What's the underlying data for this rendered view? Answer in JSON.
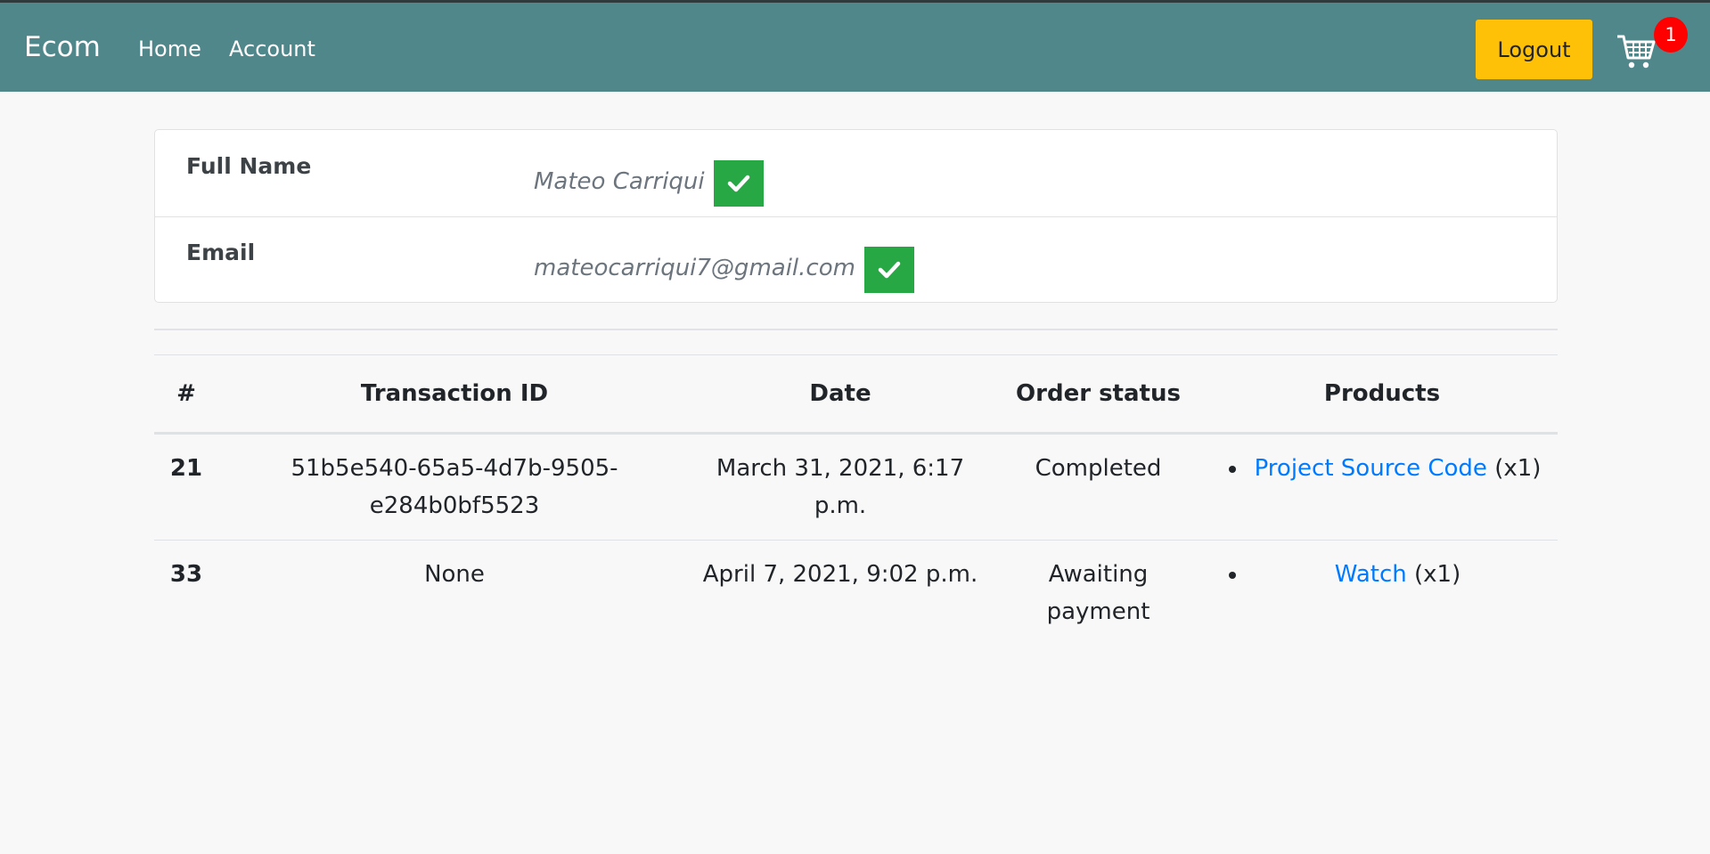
{
  "navbar": {
    "brand": "Ecom",
    "links": [
      {
        "label": "Home"
      },
      {
        "label": "Account"
      }
    ],
    "logout_label": "Logout",
    "cart_count": "1"
  },
  "account": {
    "full_name_label": "Full Name",
    "full_name_value": "Mateo Carriqui",
    "email_label": "Email",
    "email_value": "mateocarriqui7@gmail.com"
  },
  "orders": {
    "headers": [
      "#",
      "Transaction ID",
      "Date",
      "Order status",
      "Products"
    ],
    "rows": [
      {
        "id": "21",
        "transaction_id": "51b5e540-65a5-4d7b-9505-e284b0bf5523",
        "date": "March 31, 2021, 6:17 p.m.",
        "status": "Completed",
        "product_name": "Project Source Code",
        "product_qty": "(x1)"
      },
      {
        "id": "33",
        "transaction_id": "None",
        "date": "April 7, 2021, 9:02 p.m.",
        "status": "Awaiting payment",
        "product_name": "Watch",
        "product_qty": "(x1)"
      }
    ]
  },
  "colors": {
    "navbar_bg": "#50878b",
    "logout_bg": "#ffc107",
    "verified_badge": "#28a745",
    "link": "#007bff",
    "cart_badge": "#ff0000"
  },
  "icons": {
    "cart": "shopping-cart-icon",
    "verified": "check-icon"
  }
}
